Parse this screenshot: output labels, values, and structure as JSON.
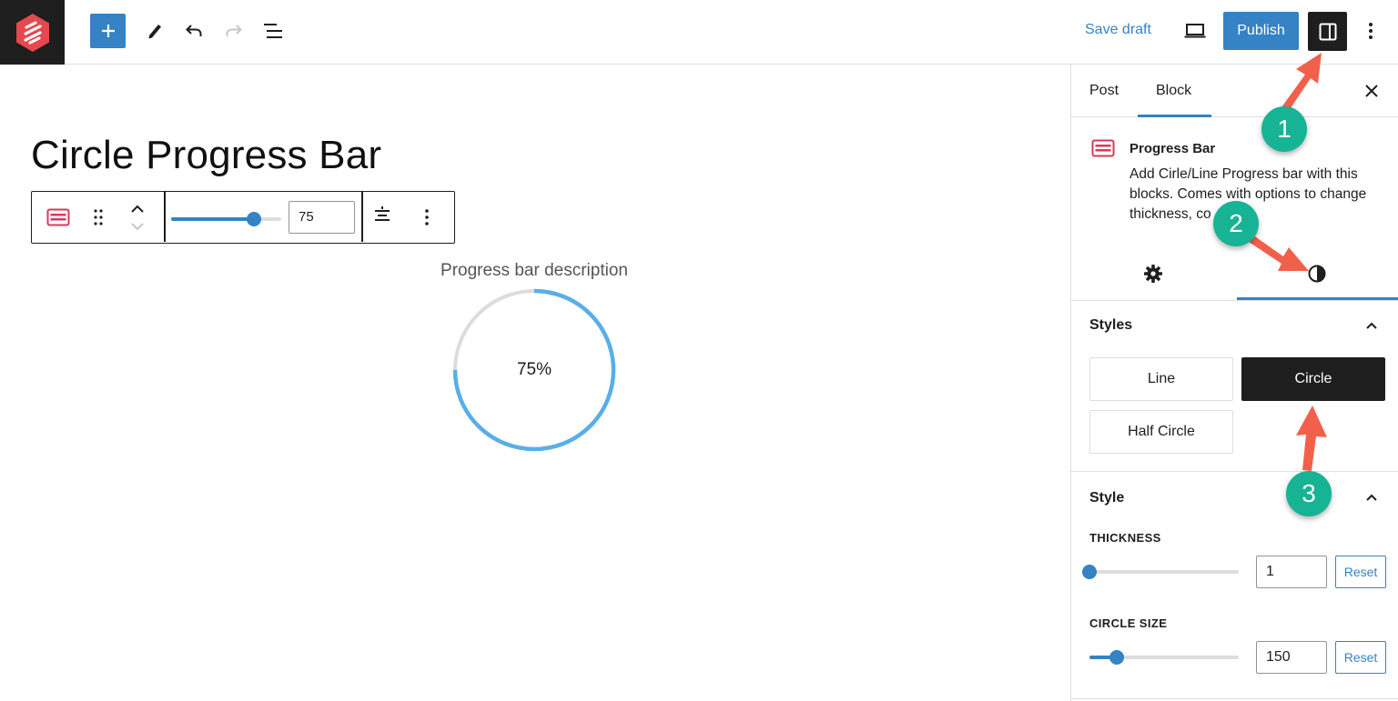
{
  "topbar": {
    "save_draft": "Save draft",
    "publish": "Publish"
  },
  "editor": {
    "post_title": "Circle Progress Bar",
    "toolbar_value": "75",
    "progress_value_fraction": 0.75,
    "progress_description": "Progress bar description",
    "circle_label": "75%",
    "circle_progress_fraction": 0.75
  },
  "sidebar": {
    "tabs": [
      {
        "label": "Post"
      },
      {
        "label": "Block"
      }
    ],
    "block": {
      "title": "Progress Bar",
      "description": "Add Cirle/Line Progress bar with this blocks. Comes with options to change thickness, co"
    },
    "styles_panel": {
      "title": "Styles",
      "options": [
        "Line",
        "Circle",
        "Half Circle"
      ],
      "selected": "Circle"
    },
    "style_panel": {
      "title": "Style",
      "thickness": {
        "label": "THICKNESS",
        "value": "1",
        "reset": "Reset",
        "slider_fraction": 0.0
      },
      "circle_size": {
        "label": "CIRCLE SIZE",
        "value": "150",
        "reset": "Reset",
        "slider_fraction": 0.18
      }
    }
  },
  "annotations": [
    "1",
    "2",
    "3"
  ],
  "colors": {
    "accent": "#3582c4",
    "dark": "#1e1e1e",
    "brand_logo": "#e5484d",
    "block_icon": "#d63a5a",
    "circle_progress": "#5aaee8",
    "circle_track": "#dcdcdc",
    "annotation_badge": "#16b394",
    "annotation_arrow": "#f2604c"
  }
}
